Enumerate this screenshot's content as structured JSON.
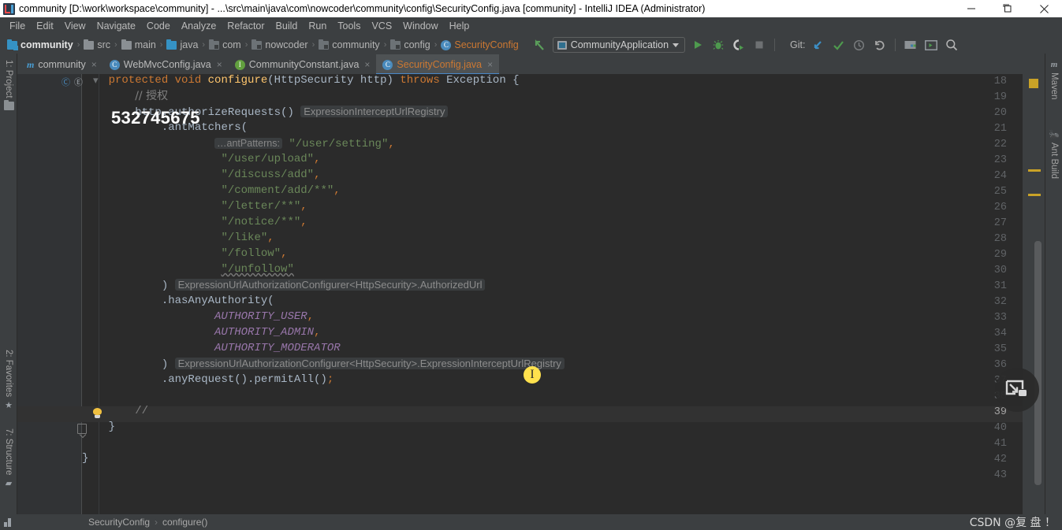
{
  "window": {
    "title": "community [D:\\work\\workspace\\community] - ...\\src\\main\\java\\com\\nowcoder\\community\\config\\SecurityConfig.java [community] - IntelliJ IDEA (Administrator)",
    "minimize_label": "minimize-icon",
    "maximize_label": "maximize-icon",
    "close_label": "close-icon"
  },
  "menu": {
    "items": [
      "File",
      "Edit",
      "View",
      "Navigate",
      "Code",
      "Analyze",
      "Refactor",
      "Build",
      "Run",
      "Tools",
      "VCS",
      "Window",
      "Help"
    ]
  },
  "breadcrumbs": {
    "items": [
      {
        "label": "community",
        "icon": "project-folder-icon"
      },
      {
        "label": "src",
        "icon": "folder-icon"
      },
      {
        "label": "main",
        "icon": "folder-icon"
      },
      {
        "label": "java",
        "icon": "source-folder-icon"
      },
      {
        "label": "com",
        "icon": "package-icon"
      },
      {
        "label": "nowcoder",
        "icon": "package-icon"
      },
      {
        "label": "community",
        "icon": "package-icon"
      },
      {
        "label": "config",
        "icon": "package-icon"
      },
      {
        "label": "SecurityConfig",
        "icon": "java-class-icon"
      }
    ],
    "separator": "›"
  },
  "toolbar": {
    "back_icon": "back-arrow-icon",
    "run_config": "CommunityApplication",
    "run_config_icon": "run-config-icon",
    "dropdown_icon": "chevron-down-icon",
    "run_icon": "run-icon",
    "debug_icon": "debug-icon",
    "run_coverage_icon": "run-with-coverage-icon",
    "stop_icon": "stop-icon",
    "git_label": "Git:",
    "git_update_icon": "update-project-icon",
    "git_commit_icon": "commit-icon",
    "git_history_icon": "history-icon",
    "git_rollback_icon": "rollback-icon",
    "settings_icon": "project-structure-icon",
    "hide_windows_icon": "hide-windows-icon",
    "search_icon": "search-everywhere-icon"
  },
  "tabs": [
    {
      "label": "community",
      "icon": "maven-module-icon",
      "active": false,
      "close": "×"
    },
    {
      "label": "WebMvcConfig.java",
      "icon": "java-class-icon",
      "active": false,
      "close": "×"
    },
    {
      "label": "CommunityConstant.java",
      "icon": "java-interface-icon",
      "active": false,
      "close": "×"
    },
    {
      "label": "SecurityConfig.java",
      "icon": "java-class-icon",
      "active": true,
      "close": "×"
    }
  ],
  "left_strip": [
    {
      "label": "1: Project",
      "icon": "project-icon"
    },
    {
      "label": "2: Favorites",
      "icon": "star-icon"
    },
    {
      "label": "7: Structure",
      "icon": "structure-icon"
    }
  ],
  "right_strip": [
    {
      "label": "Maven",
      "icon": "maven-icon"
    },
    {
      "label": "Ant Build",
      "icon": "ant-icon"
    }
  ],
  "editor": {
    "first_line": 18,
    "last_line": 43,
    "current_line": 39,
    "lines": [
      {
        "n": 18,
        "text": "    protected void configure(HttpSecurity http) throws Exception {"
      },
      {
        "n": 19,
        "text": "        // 授权"
      },
      {
        "n": 20,
        "text": "        http.authorizeRequests()  ExpressionInterceptUrlRegistry"
      },
      {
        "n": 21,
        "text": "            .antMatchers("
      },
      {
        "n": 22,
        "text": "                    ...antPatterns: \"/user/setting\","
      },
      {
        "n": 23,
        "text": "                    \"/user/upload\","
      },
      {
        "n": 24,
        "text": "                    \"/discuss/add\","
      },
      {
        "n": 25,
        "text": "                    \"/comment/add/**\","
      },
      {
        "n": 26,
        "text": "                    \"/letter/**\","
      },
      {
        "n": 27,
        "text": "                    \"/notice/**\","
      },
      {
        "n": 28,
        "text": "                    \"/like\","
      },
      {
        "n": 29,
        "text": "                    \"/follow\","
      },
      {
        "n": 30,
        "text": "                    \"/unfollow\""
      },
      {
        "n": 31,
        "text": "            )  ExpressionUrlAuthorizationConfigurer<HttpSecurity>.AuthorizedUrl"
      },
      {
        "n": 32,
        "text": "            .hasAnyAuthority("
      },
      {
        "n": 33,
        "text": "                    AUTHORITY_USER,"
      },
      {
        "n": 34,
        "text": "                    AUTHORITY_ADMIN,"
      },
      {
        "n": 35,
        "text": "                    AUTHORITY_MODERATOR"
      },
      {
        "n": 36,
        "text": "            )  ExpressionUrlAuthorizationConfigurer<HttpSecurity>.ExpressionInterceptUrlRegistry"
      },
      {
        "n": 37,
        "text": "            .anyRequest().permitAll();"
      },
      {
        "n": 38,
        "text": ""
      },
      {
        "n": 39,
        "text": "        //"
      },
      {
        "n": 40,
        "text": "    }"
      },
      {
        "n": 41,
        "text": ""
      },
      {
        "n": 42,
        "text": "}"
      },
      {
        "n": 43,
        "text": ""
      }
    ],
    "tokens": {
      "kw_protected": "protected",
      "kw_void": "void",
      "fn_configure": "configure",
      "type_httpsecurity": "HttpSecurity",
      "param_http": "http",
      "kw_throws": "throws",
      "type_exception": "Exception",
      "comment_cn": "// 授权",
      "comment_empty": "//",
      "call_authorize": "http.authorizeRequests()",
      "hint_registry": "ExpressionInterceptUrlRegistry",
      "call_antmatchers": ".antMatchers(",
      "param_hint_antpatterns": "…antPatterns:",
      "s1": "\"/user/setting\"",
      "s2": "\"/user/upload\"",
      "s3": "\"/discuss/add\"",
      "s4": "\"/comment/add/**\"",
      "s5": "\"/letter/**\"",
      "s6": "\"/notice/**\"",
      "s7": "\"/like\"",
      "s8": "\"/follow\"",
      "s9": "\"/unfollow\"",
      "hint_authorizedurl": "ExpressionUrlAuthorizationConfigurer<HttpSecurity>.AuthorizedUrl",
      "hint_intercept": "ExpressionUrlAuthorizationConfigurer<HttpSecurity>.ExpressionInterceptUrlRegistry",
      "call_hasanyauthority": ".hasAnyAuthority(",
      "c1": "AUTHORITY_USER",
      "c2": "AUTHORITY_ADMIN",
      "c3": "AUTHORITY_MODERATOR",
      "call_anyrequest": ".anyRequest().permitAll()",
      "close_paren": ")",
      "close_brace": "}",
      "comma": ",",
      "semi": ";"
    }
  },
  "overlays": {
    "watermark_number": "532745675",
    "csdn_watermark": "CSDN @复 盘 ！",
    "float_button_icon": "screen-capture-icon",
    "text_cursor_icon": "text-cursor-icon"
  },
  "status_bar": {
    "breadcrumb": [
      "SecurityConfig",
      "configure()"
    ],
    "separator": "›",
    "left_icon": "show-tool-windows-icon"
  },
  "colors": {
    "accent_blue": "#4a88c7",
    "keyword_orange": "#cc7832",
    "string_green": "#6a8759",
    "static_purple": "#9876aa",
    "editor_bg": "#2b2b2b",
    "chrome_bg": "#3c3f41",
    "marker_yellow": "#c9a227"
  }
}
